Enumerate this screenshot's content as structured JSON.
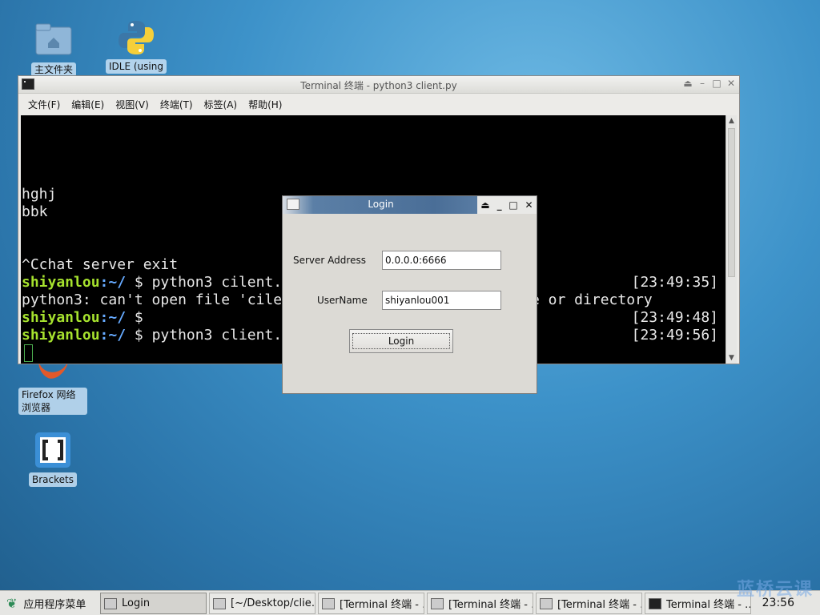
{
  "desktop": {
    "icons": [
      {
        "label": "主文件夹"
      },
      {
        "label": "IDLE (using"
      },
      {
        "label": "Firefox 网络浏览器"
      },
      {
        "label": "Brackets"
      }
    ]
  },
  "terminal": {
    "title": "Terminal 终端 - python3 client.py",
    "menu": [
      "文件(F)",
      "编辑(E)",
      "视图(V)",
      "终端(T)",
      "标签(A)",
      "帮助(H)"
    ],
    "lines": [
      {
        "text": "hghj"
      },
      {
        "text": "bbk"
      },
      {
        "text": "^Cchat server exit"
      },
      {
        "user": "shiyanlou",
        "path": ":~/",
        "cmd": " $ python3 cilent.",
        "ts": "[23:49:35]"
      },
      {
        "text": "python3: can't open file 'cile",
        "tail": "e or directory"
      },
      {
        "user": "shiyanlou",
        "path": ":~/",
        "cmd": " $",
        "ts": "[23:49:48]"
      },
      {
        "user": "shiyanlou",
        "path": ":~/",
        "cmd": " $ python3 client.",
        "ts": "[23:49:56]"
      }
    ]
  },
  "login": {
    "title": "Login",
    "server_label": "Server Address",
    "server_value": "0.0.0.0:6666",
    "user_label": "UserName",
    "user_value": "shiyanlou001",
    "button_label": "Login"
  },
  "taskbar": {
    "menu_label": "应用程序菜单",
    "items": [
      {
        "label": "Login"
      },
      {
        "label": "[~/Desktop/clie…"
      },
      {
        "label": "[Terminal 终端 - …"
      },
      {
        "label": "[Terminal 终端 - …"
      },
      {
        "label": "[Terminal 终端 - …"
      },
      {
        "label": "Terminal 终端 - …"
      }
    ],
    "clock": "23:56"
  },
  "watermark": "蓝桥云课"
}
